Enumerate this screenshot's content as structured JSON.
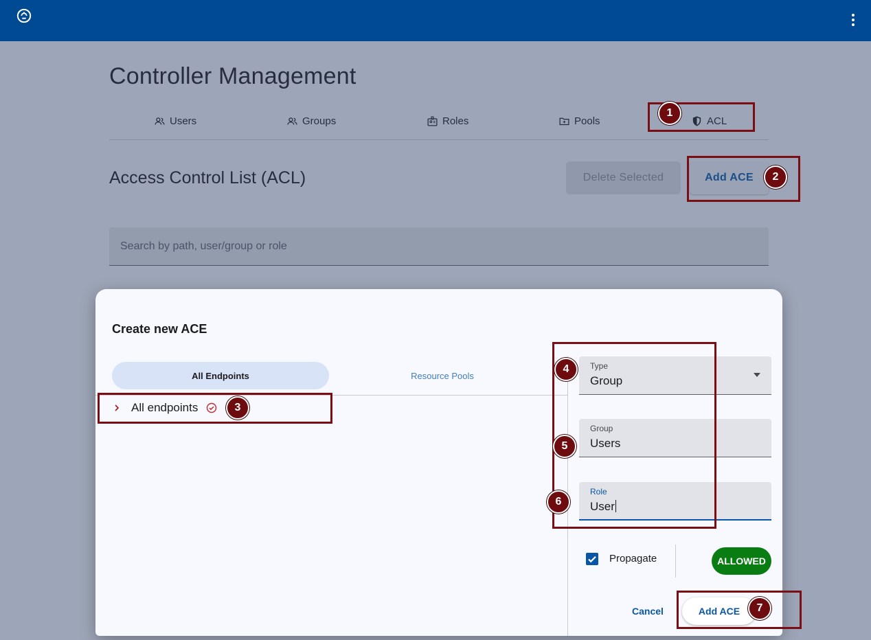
{
  "page": {
    "title": "Controller Management",
    "tabs": [
      {
        "label": "Users",
        "icon": "people-icon"
      },
      {
        "label": "Groups",
        "icon": "people-icon"
      },
      {
        "label": "Roles",
        "icon": "badge-icon"
      },
      {
        "label": "Pools",
        "icon": "folder-icon"
      },
      {
        "label": "ACL",
        "icon": "shield-icon"
      }
    ],
    "section_title": "Access Control List (ACL)",
    "delete_button": "Delete Selected",
    "add_button": "Add ACE",
    "search_placeholder": "Search by path, user/group or role"
  },
  "dialog": {
    "title": "Create new ACE",
    "segments": [
      "All Endpoints",
      "Resource Pools"
    ],
    "tree_item": "All endpoints",
    "fields": {
      "type": {
        "label": "Type",
        "value": "Group"
      },
      "group": {
        "label": "Group",
        "value": "Users"
      },
      "role": {
        "label": "Role",
        "value": "User"
      }
    },
    "propagate_label": "Propagate",
    "propagate_checked": true,
    "allowed_label": "ALLOWED",
    "cancel_label": "Cancel",
    "submit_label": "Add ACE"
  },
  "annotations": [
    "1",
    "2",
    "3",
    "4",
    "5",
    "6",
    "7"
  ],
  "colors": {
    "topbar": "#004a94",
    "primary": "#0a56a6",
    "allowed": "#0a7d12",
    "highlight": "#7a0e12"
  }
}
